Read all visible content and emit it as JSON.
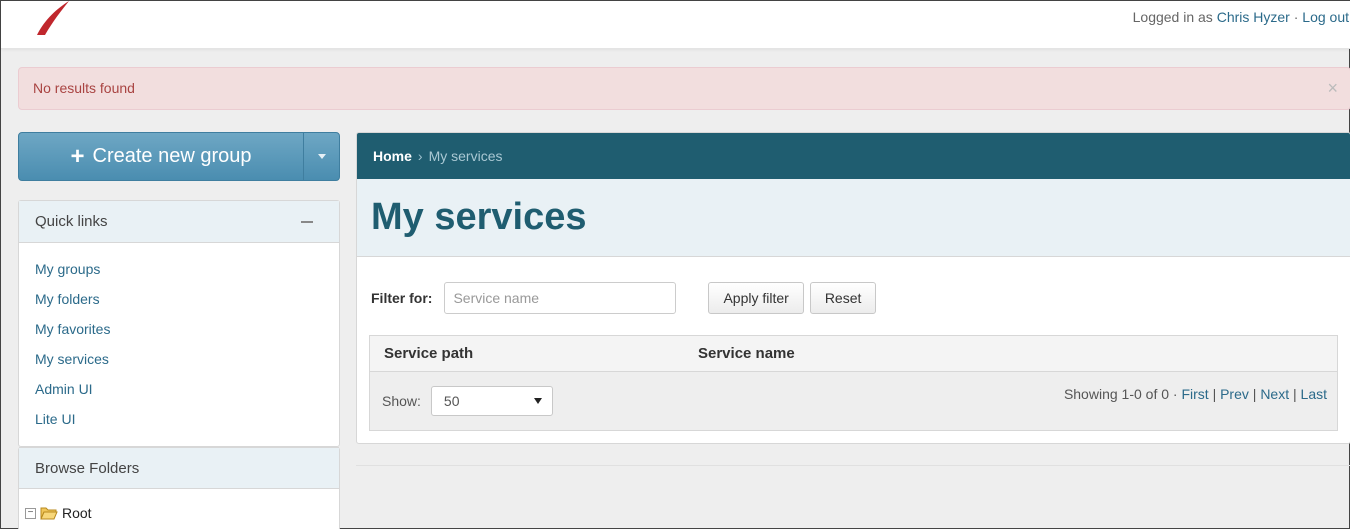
{
  "header": {
    "logged_in_prefix": "Logged in as",
    "user_name": "Chris Hyzer",
    "separator": "·",
    "logout_label": "Log out"
  },
  "alert": {
    "message": "No results found",
    "close_glyph": "×"
  },
  "create_group": {
    "label": "Create new group",
    "plus_glyph": "+"
  },
  "quick_links": {
    "title": "Quick links",
    "items": [
      {
        "label": "My groups"
      },
      {
        "label": "My folders"
      },
      {
        "label": "My favorites"
      },
      {
        "label": "My services"
      },
      {
        "label": "Admin UI"
      },
      {
        "label": "Lite UI"
      }
    ]
  },
  "browse_folders": {
    "title": "Browse Folders",
    "root_label": "Root",
    "expander_glyph": "−"
  },
  "breadcrumb": {
    "home": "Home",
    "separator": "›",
    "current": "My services"
  },
  "page": {
    "title": "My services"
  },
  "filter": {
    "label": "Filter for:",
    "placeholder": "Service name",
    "value": "",
    "apply_label": "Apply filter",
    "reset_label": "Reset"
  },
  "table": {
    "columns": [
      "Service path",
      "Service name"
    ],
    "rows": []
  },
  "pagination": {
    "show_label": "Show:",
    "page_size": "50",
    "summary": "Showing 1-0 of 0 ·",
    "first": "First",
    "prev": "Prev",
    "next": "Next",
    "last": "Last",
    "divider": "|"
  },
  "colors": {
    "brand_dark": "#1f5d70",
    "link": "#2b6a8a",
    "alert_bg": "#f2dede",
    "alert_text": "#a94442",
    "button_blue": "#4a8db0"
  }
}
